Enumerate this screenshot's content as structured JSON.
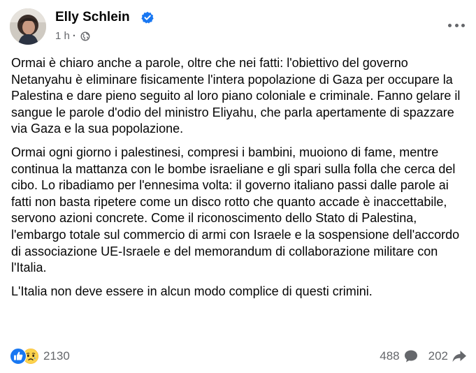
{
  "post": {
    "author": "Elly Schlein",
    "time": "1 h",
    "dot": "·",
    "paragraphs": [
      "Ormai è chiaro anche a parole, oltre che nei fatti: l'obiettivo del governo Netanyahu è eliminare fisicamente l'intera popolazione di Gaza per occupare la Palestina e dare pieno seguito al loro piano coloniale e criminale. Fanno gelare il sangue le parole d'odio del ministro Eliyahu, che parla apertamente di spazzare via Gaza e la sua popolazione.",
      "Ormai ogni giorno i palestinesi, compresi i bambini, muoiono di fame, mentre continua la mattanza con le bombe israeliane e gli spari sulla folla che cerca del cibo. Lo ribadiamo per l'ennesima volta: il governo italiano passi dalle parole ai fatti non basta ripetere come un disco rotto che quanto accade è inaccettabile, servono azioni concrete. Come il riconoscimento dello Stato di Palestina, l'embargo totale sul commercio di armi con Israele e la sospensione dell'accordo di associazione UE-Israele e del memorandum di collaborazione militare con l'Italia.",
      "L'Italia non deve essere in alcun modo complice di questi crimini."
    ]
  },
  "footer": {
    "reactions_count": "2130",
    "comments_count": "488",
    "shares_count": "202"
  },
  "icons": {
    "verified": "verified-badge-icon",
    "audience": "globe-icon",
    "more": "more-options-icon",
    "like": "like-reaction-icon",
    "sad": "sad-reaction-icon",
    "comment": "comment-icon",
    "share": "share-icon"
  },
  "colors": {
    "brand_blue": "#1877f2",
    "secondary_text": "#65676b",
    "primary_text": "#050505"
  }
}
